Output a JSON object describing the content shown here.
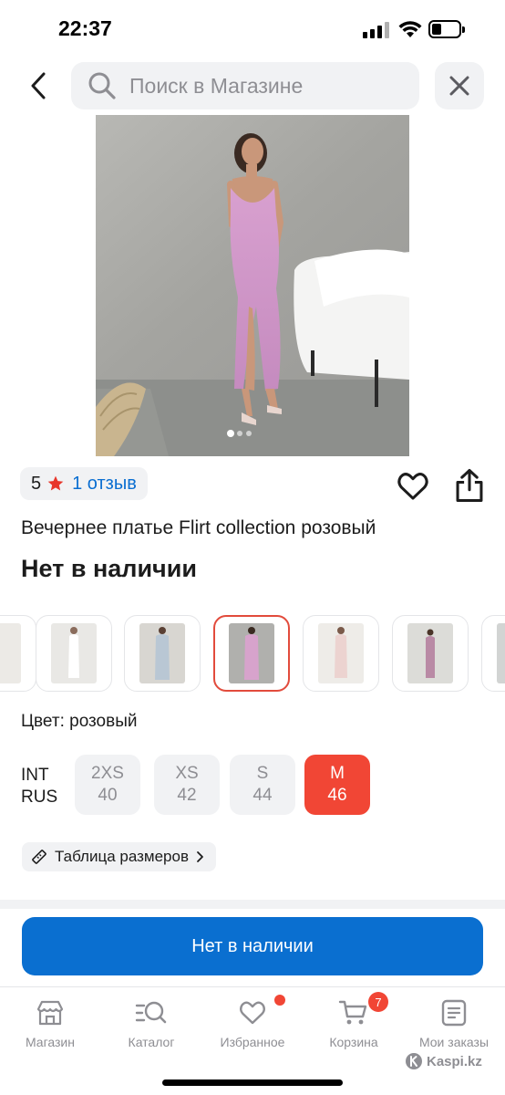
{
  "status_bar": {
    "time": "22:37"
  },
  "search": {
    "placeholder": "Поиск в Магазине"
  },
  "product": {
    "rating": "5",
    "reviews_label": "1 отзыв",
    "title": "Вечернее платье Flirt collection розовый",
    "stock_status": "Нет в наличии",
    "color_label": "Цвет: розовый",
    "selected_thumbnail_index": 3,
    "image_count": 3,
    "active_image_index": 0
  },
  "sizes": {
    "system_top": "INT",
    "system_bottom": "RUS",
    "options": [
      {
        "int": "2XS",
        "rus": "40",
        "active": false
      },
      {
        "int": "XS",
        "rus": "42",
        "active": false
      },
      {
        "int": "S",
        "rus": "44",
        "active": false
      },
      {
        "int": "M",
        "rus": "46",
        "active": true
      }
    ],
    "table_label": "Таблица размеров"
  },
  "cta": {
    "label": "Нет в наличии"
  },
  "tabbar": {
    "tabs": [
      {
        "label": "Магазин",
        "icon": "store-icon"
      },
      {
        "label": "Каталог",
        "icon": "catalog-search-icon"
      },
      {
        "label": "Избранное",
        "icon": "heart-icon"
      },
      {
        "label": "Корзина",
        "icon": "cart-icon"
      },
      {
        "label": "Мои заказы",
        "icon": "orders-icon"
      }
    ],
    "cart_badge": "7"
  },
  "watermark": "Kaspi.kz",
  "colors": {
    "accent_blue": "#0a6fd0",
    "accent_red": "#f14635",
    "chip_bg": "#f1f2f4",
    "muted_text": "#8e8e93"
  }
}
